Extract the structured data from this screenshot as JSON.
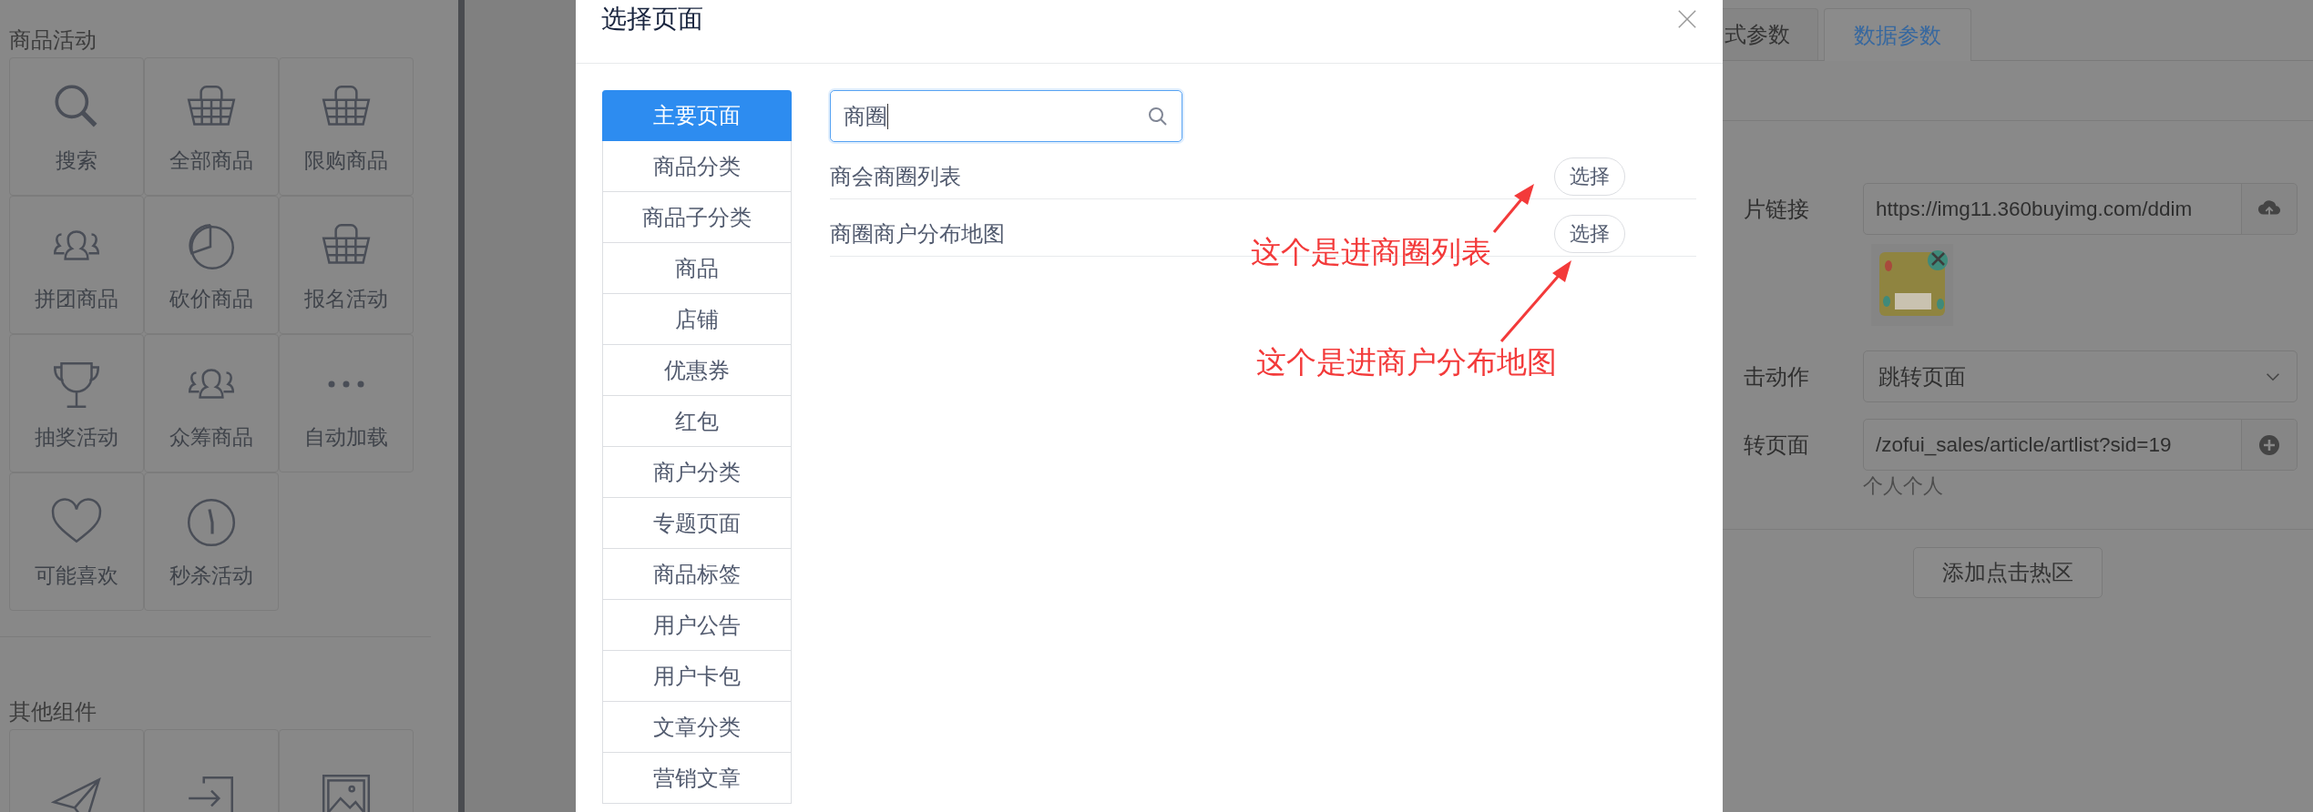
{
  "left_panel": {
    "sections": [
      {
        "title": "商品活动",
        "tiles": [
          {
            "label": "搜索"
          },
          {
            "label": "全部商品"
          },
          {
            "label": "限购商品"
          },
          {
            "label": "拼团商品"
          },
          {
            "label": "砍价商品"
          },
          {
            "label": "报名活动"
          },
          {
            "label": "抽奖活动"
          },
          {
            "label": "众筹商品"
          },
          {
            "label": "自动加载"
          },
          {
            "label": "可能喜欢"
          },
          {
            "label": "秒杀活动"
          }
        ]
      },
      {
        "title": "其他组件"
      }
    ]
  },
  "dialog": {
    "title": "选择页面",
    "menu": [
      {
        "label": "主要页面",
        "selected": true
      },
      {
        "label": "商品分类",
        "selected": false
      },
      {
        "label": "商品子分类",
        "selected": false
      },
      {
        "label": "商品",
        "selected": false
      },
      {
        "label": "店铺",
        "selected": false
      },
      {
        "label": "优惠券",
        "selected": false
      },
      {
        "label": "红包",
        "selected": false
      },
      {
        "label": "商户分类",
        "selected": false
      },
      {
        "label": "专题页面",
        "selected": false
      },
      {
        "label": "商品标签",
        "selected": false
      },
      {
        "label": "用户公告",
        "selected": false
      },
      {
        "label": "用户卡包",
        "selected": false
      },
      {
        "label": "文章分类",
        "selected": false
      },
      {
        "label": "营销文章",
        "selected": false
      }
    ],
    "search": {
      "value": "商圈"
    },
    "results": [
      {
        "label": "商会商圈列表",
        "button": "选择"
      },
      {
        "label": "商圈商户分布地图",
        "button": "选择"
      }
    ],
    "annotations": [
      {
        "text": "这个是进商圈列表"
      },
      {
        "text": "这个是进商户分布地图"
      }
    ]
  },
  "right_panel": {
    "tabs": [
      {
        "label": "式参数",
        "selected": false
      },
      {
        "label": "数据参数",
        "selected": true
      }
    ],
    "image_link": {
      "label": "片链接",
      "value": "https://img11.360buyimg.com/ddim"
    },
    "click_action": {
      "label": "击动作",
      "value": "跳转页面"
    },
    "jump_page": {
      "label": "转页面",
      "value": "/zofui_sales/article/artlist?sid=19",
      "hint": "个人个人"
    },
    "add_button": "添加点击热区"
  }
}
